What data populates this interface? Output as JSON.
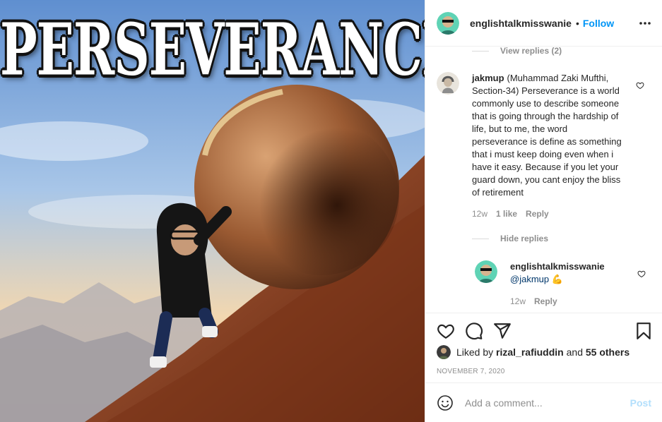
{
  "image": {
    "title_text": "PERSEVERANCE"
  },
  "header": {
    "username": "englishtalkmisswanie",
    "separator": "•",
    "follow_label": "Follow",
    "more_icon": "more-options-icon"
  },
  "comments": {
    "view_replies_label": "View replies (2)",
    "main_comment": {
      "username": "jakmup",
      "text": "(Muhammad Zaki Mufthi, Section-34) Perseverance is a world commonly use to describe someone that is going through the hardship of life, but to me, the word perseverance is define as something that i must keep doing even when i have it easy. Because if you let your guard down, you cant enjoy the bliss of retirement",
      "time": "12w",
      "likes": "1 like",
      "reply_label": "Reply"
    },
    "hide_replies_label": "Hide replies",
    "reply": {
      "username": "englishtalkmisswanie",
      "mention": "@jakmup",
      "emoji": "💪",
      "time": "12w",
      "reply_label": "Reply"
    }
  },
  "actions": {
    "icons": [
      "heart-icon",
      "comment-icon",
      "share-icon",
      "bookmark-icon"
    ],
    "liked_by_prefix": "Liked by",
    "liked_by_user": "rizal_rafiuddin",
    "and_label": "and",
    "others_label": "55 others",
    "date": "NOVEMBER 7, 2020"
  },
  "add_comment": {
    "placeholder": "Add a comment...",
    "post_label": "Post"
  },
  "colors": {
    "accent": "#0095f6",
    "post_disabled": "#b2dffc",
    "mention": "#00376b",
    "muted": "#8e8e8e"
  }
}
